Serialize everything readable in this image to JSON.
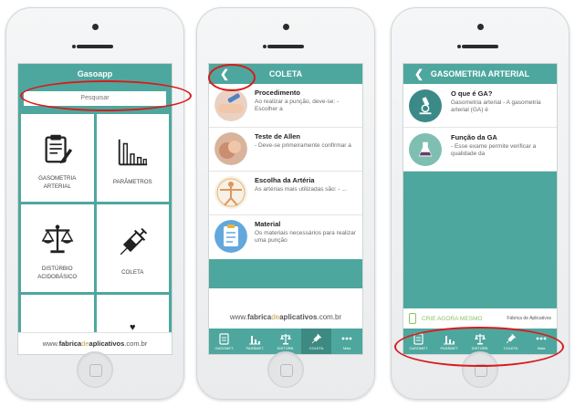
{
  "footer_site": {
    "prefix": "www.",
    "part1": "fabrica",
    "part2": "de",
    "part3": "aplicativos",
    "suffix": ".com.br"
  },
  "phone1": {
    "title": "Gasoapp",
    "search_placeholder": "Pesquisar",
    "tiles": [
      {
        "label": "GASOMETRIA\nARTERIAL",
        "icon": "clipboard-pen-icon"
      },
      {
        "label": "PARÂMETROS",
        "icon": "bar-chart-icon"
      },
      {
        "label": "DISTÚRBIO\nACIDOBÁSICO",
        "icon": "balance-scale-icon"
      },
      {
        "label": "COLETA",
        "icon": "syringe-icon"
      }
    ]
  },
  "phone2": {
    "title": "COLETA",
    "items": [
      {
        "title": "Procedimento",
        "desc": "Ao realizar a punção, deve-se: - Escolher a"
      },
      {
        "title": "Teste de Allen",
        "desc": "- Deve-se primeiramente confirmar a"
      },
      {
        "title": "Escolha da Artéria",
        "desc": "As artérias mais utilizadas são: - ..."
      },
      {
        "title": "Material",
        "desc": "Os materiais necessários para realizar uma punção"
      }
    ],
    "tabs": [
      {
        "label": "GASOMET.",
        "icon": "clipboard-icon"
      },
      {
        "label": "PARÂMET.",
        "icon": "bar-chart-icon"
      },
      {
        "label": "DISTÚRB.",
        "icon": "balance-scale-icon"
      },
      {
        "label": "COLETA",
        "icon": "syringe-icon"
      },
      {
        "label": "Mais",
        "icon": "more-icon"
      }
    ]
  },
  "phone3": {
    "title": "GASOMETRIA ARTERIAL",
    "items": [
      {
        "title": "O que é GA?",
        "desc": "Gasometria arterial - A gasometria arterial (GA) é"
      },
      {
        "title": "Função da GA",
        "desc": "- Esse exame permite verificar a qualidade da"
      }
    ],
    "ad_text": "CRIE AGORA MESMO",
    "ad_brand": "Fábrica de Aplicativos",
    "tabs": [
      {
        "label": "GASOMET.",
        "icon": "clipboard-icon"
      },
      {
        "label": "PARÂMET.",
        "icon": "bar-chart-icon"
      },
      {
        "label": "DISTÚRB.",
        "icon": "balance-scale-icon"
      },
      {
        "label": "COLETA",
        "icon": "syringe-icon"
      },
      {
        "label": "Mais",
        "icon": "more-icon"
      }
    ]
  },
  "colors": {
    "teal": "#4ea79e",
    "teal_dark": "#3d8a82",
    "annotation_red": "#d71c1c",
    "footer_accent": "#c4a24d"
  }
}
